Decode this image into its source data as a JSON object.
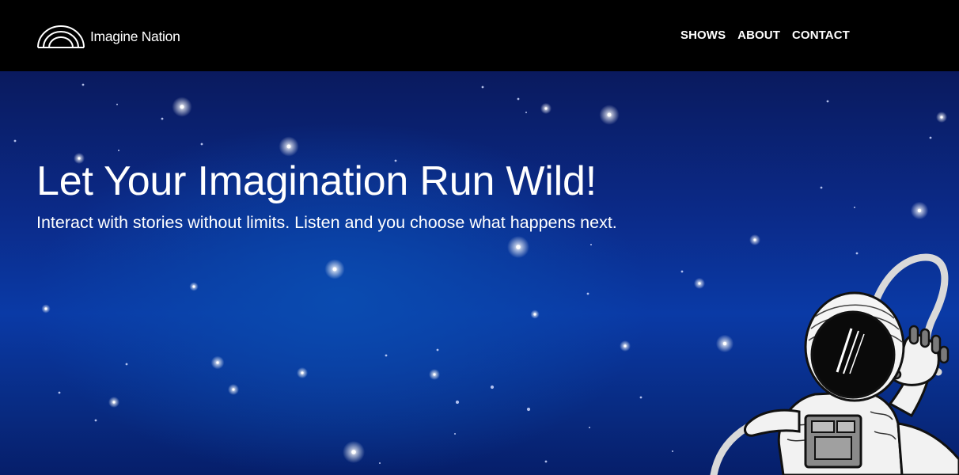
{
  "header": {
    "brand": "Imagine Nation",
    "nav": [
      {
        "label": "SHOWS"
      },
      {
        "label": "ABOUT"
      },
      {
        "label": "CONTACT"
      }
    ]
  },
  "hero": {
    "title": "Let Your Imagination Run Wild!",
    "subtitle": "Interact with stories without limits. Listen and you choose what happens next.",
    "illustration": "astronaut-illustration"
  },
  "colors": {
    "header_bg": "#000000",
    "hero_bg_top": "#0a1a5e",
    "hero_bg_mid": "#0a3aa6",
    "text": "#ffffff"
  }
}
